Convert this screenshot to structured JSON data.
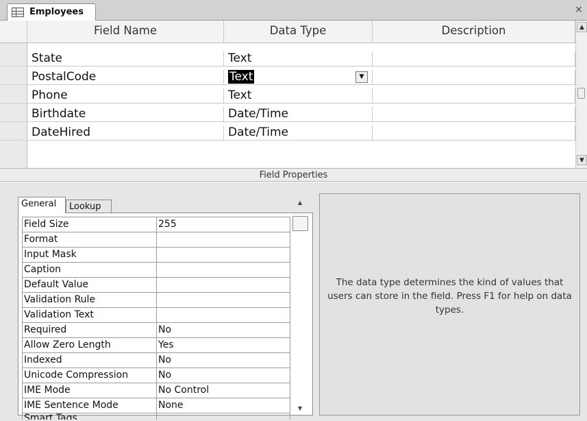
{
  "tab": {
    "label": "Employees",
    "icon": "table-icon",
    "close": "×"
  },
  "grid": {
    "headers": {
      "field_name": "Field Name",
      "data_type": "Data Type",
      "description": "Description"
    },
    "rows": [
      {
        "field_name": "State",
        "data_type": "Text",
        "description": ""
      },
      {
        "field_name": "PostalCode",
        "data_type": "Text",
        "description": ""
      },
      {
        "field_name": "Phone",
        "data_type": "Text",
        "description": ""
      },
      {
        "field_name": "Birthdate",
        "data_type": "Date/Time",
        "description": ""
      },
      {
        "field_name": "DateHired",
        "data_type": "Date/Time",
        "description": ""
      }
    ],
    "selected_row_index": 1
  },
  "field_properties": {
    "title": "Field Properties",
    "tabs": {
      "general": "General",
      "lookup": "Lookup"
    },
    "active_tab": "general",
    "properties": [
      {
        "name": "Field Size",
        "value": "255"
      },
      {
        "name": "Format",
        "value": ""
      },
      {
        "name": "Input Mask",
        "value": ""
      },
      {
        "name": "Caption",
        "value": ""
      },
      {
        "name": "Default Value",
        "value": ""
      },
      {
        "name": "Validation Rule",
        "value": ""
      },
      {
        "name": "Validation Text",
        "value": ""
      },
      {
        "name": "Required",
        "value": "No"
      },
      {
        "name": "Allow Zero Length",
        "value": "Yes"
      },
      {
        "name": "Indexed",
        "value": "No"
      },
      {
        "name": "Unicode Compression",
        "value": "No"
      },
      {
        "name": "IME Mode",
        "value": "No Control"
      },
      {
        "name": "IME Sentence Mode",
        "value": "None"
      },
      {
        "name": "Smart Tags",
        "value": ""
      }
    ],
    "help_text": "The data type determines the kind of values that users can store in the field. Press F1 for help on data types."
  }
}
